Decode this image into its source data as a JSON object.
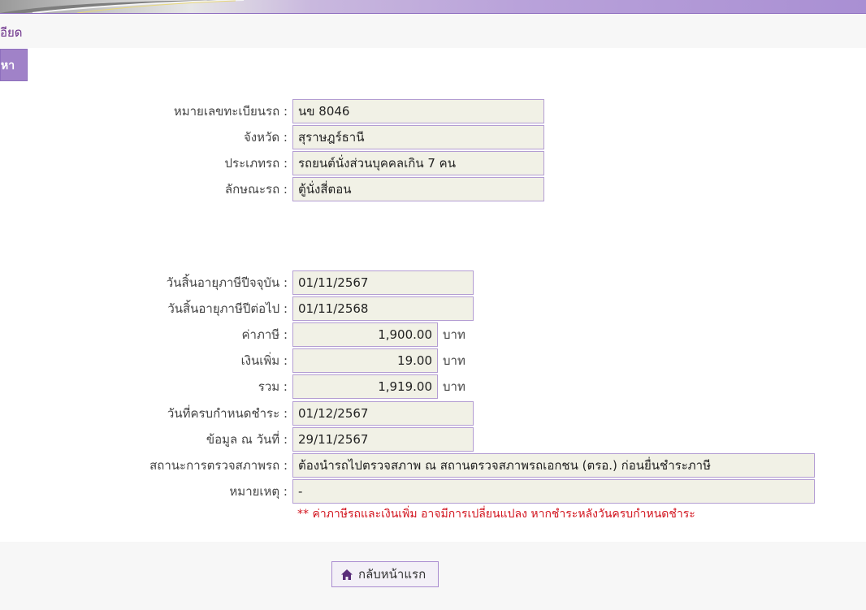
{
  "header": {
    "breadcrumb": "อียด",
    "search_button": "หา"
  },
  "vehicle": {
    "plate_label": "หมายเลขทะเบียนรถ :",
    "plate": "นข 8046",
    "province_label": "จังหวัด :",
    "province": "สุราษฎร์ธานี",
    "type_label": "ประเภทรถ :",
    "type": "รถยนต์นั่งส่วนบุคคลเกิน 7 คน",
    "style_label": "ลักษณะรถ :",
    "style": "ตู้นั่งสี่ตอน"
  },
  "tax": {
    "current_expiry_label": "วันสิ้นอายุภาษีปีจจุบัน :",
    "current_expiry": "01/11/2567",
    "next_expiry_label": "วันสิ้นอายุภาษีปีต่อไป :",
    "next_expiry": "01/11/2568",
    "fee_label": "ค่าภาษี :",
    "fee": "1,900.00",
    "surcharge_label": "เงินเพิ่ม :",
    "surcharge": "19.00",
    "total_label": "รวม :",
    "total": "1,919.00",
    "unit": "บาท",
    "due_label": "วันที่ครบกำหนดชำระ :",
    "due": "01/12/2567",
    "as_of_label": "ข้อมูล ณ วันที่ :",
    "as_of": "29/11/2567",
    "inspection_label": "สถานะการตรวจสภาพรถ :",
    "inspection": "ต้องนำรถไปตรวจสภาพ ณ สถานตรวจสภาพรถเอกชน (ตรอ.) ก่อนยื่นชำระภาษี",
    "remark_label": "หมายเหตุ :",
    "remark": "-",
    "note": "** ค่าภาษีรถและเงินเพิ่ม อาจมีการเปลี่ยนแปลง หากชำระหลังวันครบกำหนดชำระ"
  },
  "footer": {
    "home_button": "กลับหน้าแรก"
  },
  "colors": {
    "accent": "#a082c8",
    "field_bg": "#f1f1e6",
    "field_border": "#b39dd2",
    "warning": "#d2141e"
  }
}
